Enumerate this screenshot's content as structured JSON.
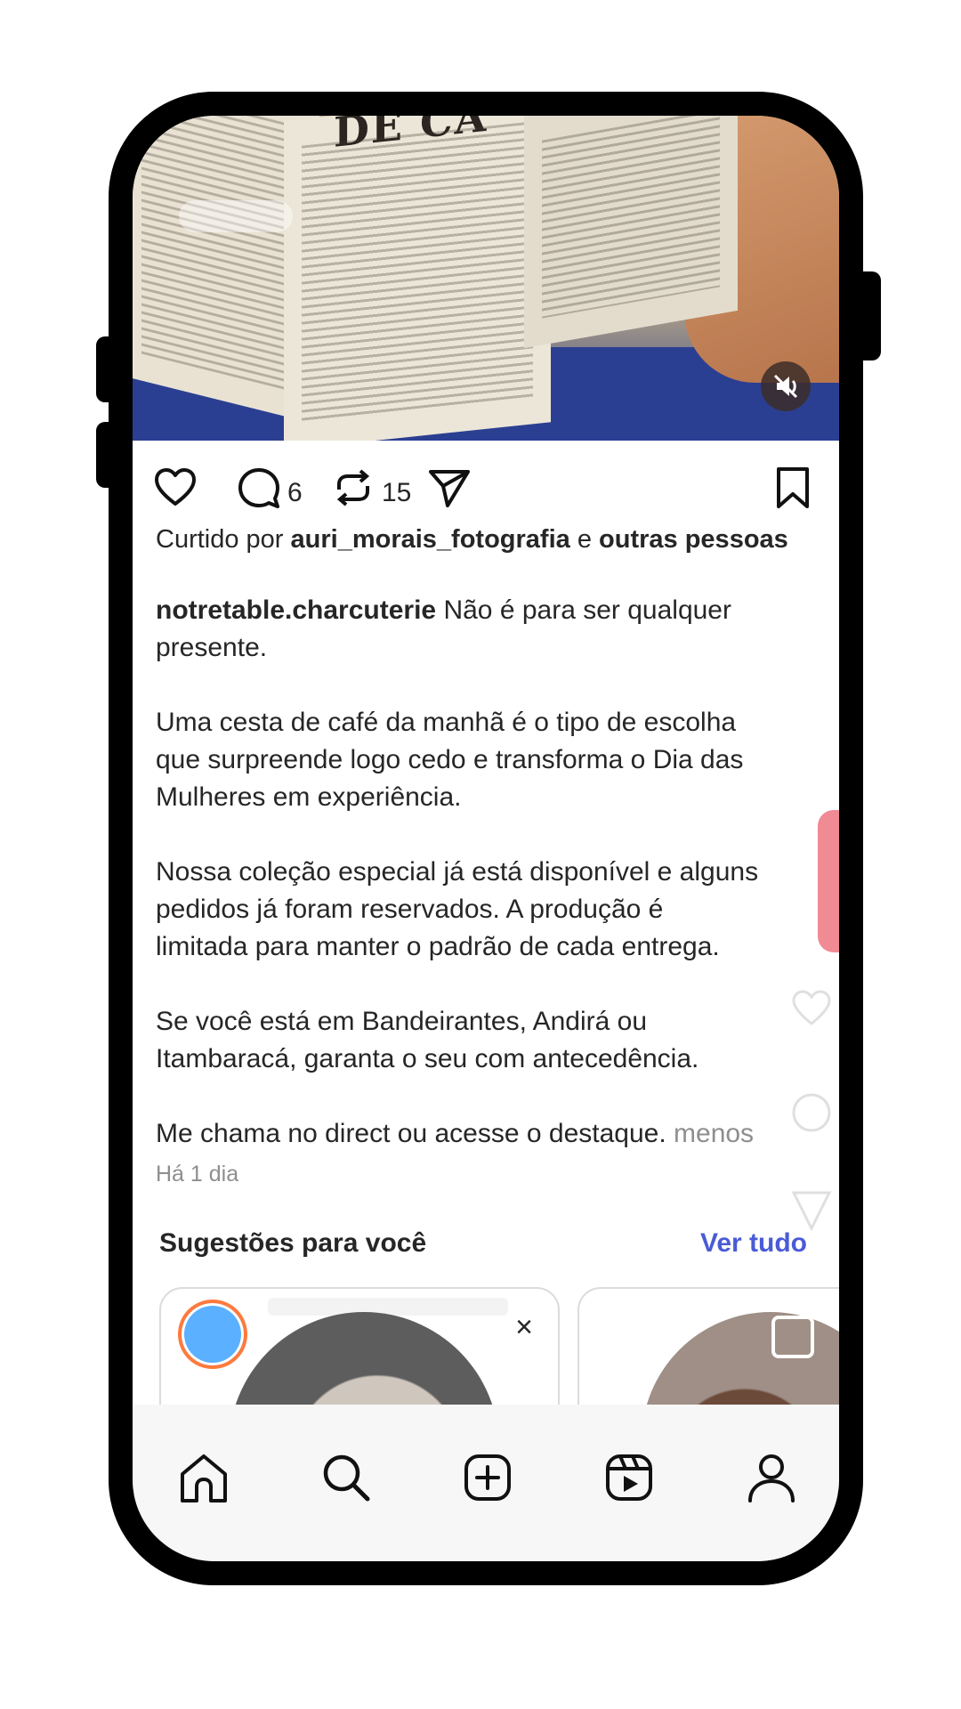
{
  "post": {
    "headline": "DE CA",
    "comments_count": "6",
    "reposts_count": "15",
    "liked_by": {
      "prefix": "Curtido por ",
      "user": "auri_morais_fotografia",
      "middle": " e ",
      "others": "outras pessoas"
    },
    "caption": {
      "username": "notretable.charcuterie",
      "p1": " Não é para ser qualquer",
      "p1b": "presente.",
      "p2a": "Uma cesta de café da manhã é o tipo de escolha",
      "p2b": "que surpreende logo cedo e transforma o Dia das",
      "p2c": "Mulheres em experiência.",
      "p3a": "Nossa coleção especial já está disponível e alguns",
      "p3b": "pedidos já foram reservados. A produção é",
      "p3c": "limitada para manter o padrão de cada entrega.",
      "p4a": "Se você está em Bandeirantes, Andirá ou",
      "p4b": "Itambaracá, garanta o seu com antecedência.",
      "p5": "Me chama no direct ou acesse o destaque. ",
      "less": "menos"
    },
    "timestamp": "Há 1 dia"
  },
  "suggestions": {
    "title": "Sugestões para você",
    "see_all": "Ver tudo",
    "close_glyph": "×"
  },
  "icons": [
    "heart-icon",
    "comment-icon",
    "repost-icon",
    "share-icon",
    "bookmark-icon",
    "mute-icon",
    "home-icon",
    "search-icon",
    "create-icon",
    "reels-icon",
    "profile-icon"
  ]
}
